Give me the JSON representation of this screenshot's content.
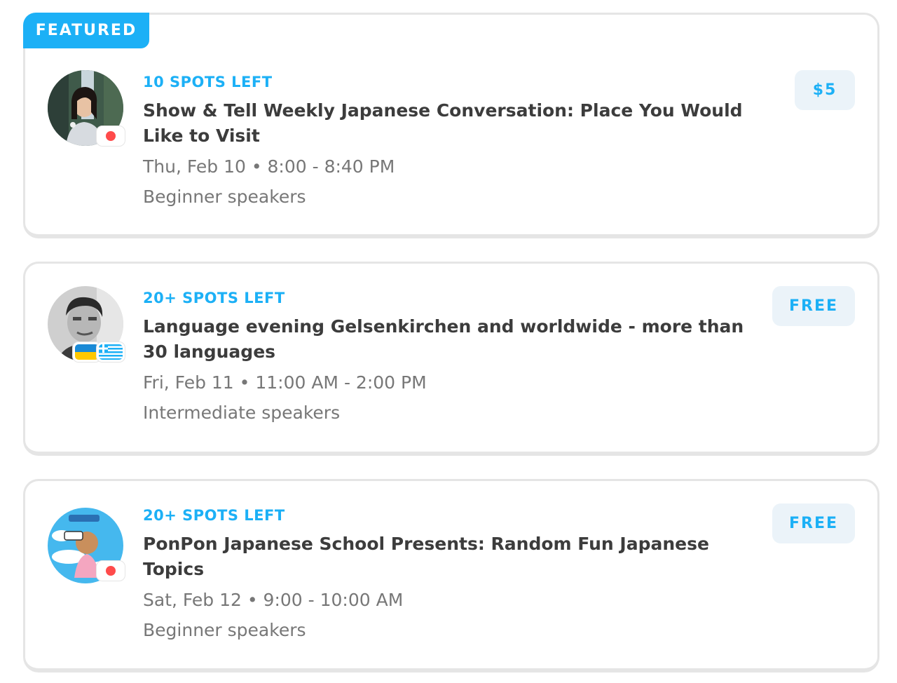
{
  "events": [
    {
      "featured_label": "FEATURED",
      "spots": "10 SPOTS LEFT",
      "title": "Show & Tell Weekly Japanese Conversation: Place You Would Like to Visit",
      "when": "Thu, Feb 10 • 8:00 - 8:40 PM",
      "level": "Beginner speakers",
      "price": "$5",
      "flags": [
        "japan-flag-icon"
      ]
    },
    {
      "spots": "20+ SPOTS LEFT",
      "title": "Language evening Gelsenkirchen and worldwide - more than 30 languages",
      "when": "Fri, Feb 11 • 11:00 AM - 2:00 PM",
      "level": "Intermediate speakers",
      "price": "FREE",
      "flags": [
        "ukraine-flag-icon",
        "greece-flag-icon"
      ]
    },
    {
      "spots": "20+ SPOTS LEFT",
      "title": "PonPon Japanese School Presents: Random Fun Japanese Topics",
      "when": "Sat, Feb 12 • 9:00 - 10:00 AM",
      "level": "Beginner speakers",
      "price": "FREE",
      "flags": [
        "japan-flag-icon"
      ]
    }
  ],
  "colors": {
    "accent": "#1cb0f6",
    "price_bg": "#ebf3f9",
    "title_text": "#3c3c3c",
    "meta_text": "#777777",
    "card_border": "#e5e5e5"
  }
}
